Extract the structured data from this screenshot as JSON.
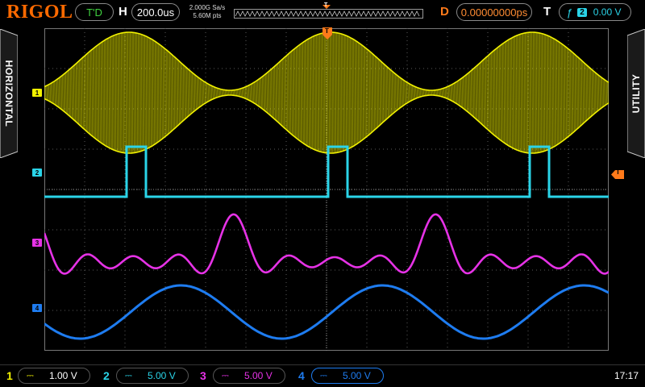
{
  "brand": "RIGOL",
  "status": {
    "run_state": "T'D",
    "h_label": "H",
    "timebase": "200.0us",
    "sample_rate": "2.000G Sa/s",
    "memory_depth": "5.60M pts",
    "d_label": "D",
    "delay": "0.00000000ps",
    "t_label": "T",
    "trigger_source": "2",
    "trigger_level": "0.00 V",
    "trigger_marker": "T"
  },
  "side_tabs": {
    "left": "HORIZONTAL",
    "right": "UTILITY"
  },
  "channels": [
    {
      "id": "1",
      "coupling": "DC",
      "scale": "1.00 V",
      "color": "#f2f200"
    },
    {
      "id": "2",
      "coupling": "DC",
      "scale": "5.00 V",
      "color": "#2ad4e8"
    },
    {
      "id": "3",
      "coupling": "DC",
      "scale": "5.00 V",
      "color": "#e632e6"
    },
    {
      "id": "4",
      "coupling": "DC",
      "scale": "5.00 V",
      "color": "#1e7cf0"
    }
  ],
  "clock": "17:17",
  "colors": {
    "accent": "#ff6a00",
    "grid": "#5a5a5a"
  }
}
